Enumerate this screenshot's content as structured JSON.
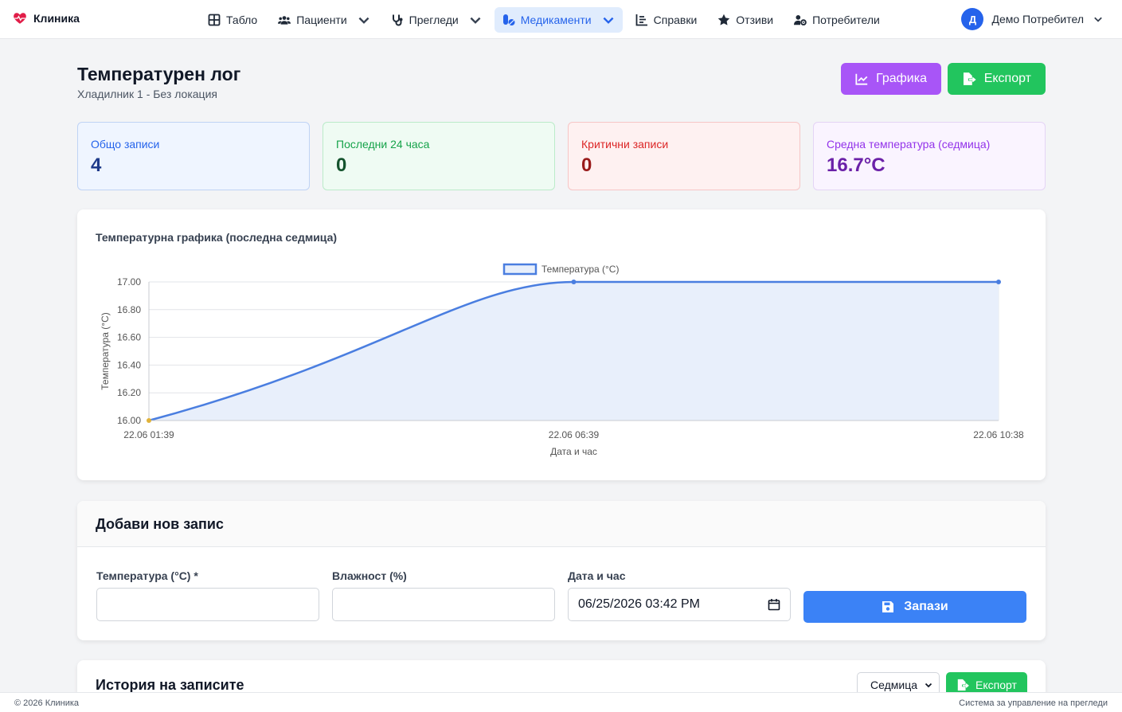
{
  "nav": {
    "brand": "Клиника",
    "items": [
      {
        "label": "Табло",
        "icon": "grid-icon",
        "dropdown": false
      },
      {
        "label": "Пациенти",
        "icon": "users-icon",
        "dropdown": true
      },
      {
        "label": "Прегледи",
        "icon": "stethoscope-icon",
        "dropdown": true
      },
      {
        "label": "Медикаменти",
        "icon": "pills-icon",
        "dropdown": true,
        "active": true
      },
      {
        "label": "Справки",
        "icon": "chart-list-icon",
        "dropdown": false
      },
      {
        "label": "Отзиви",
        "icon": "star-icon",
        "dropdown": false
      },
      {
        "label": "Потребители",
        "icon": "users-gear-icon",
        "dropdown": false
      }
    ],
    "user_initial": "Д",
    "user_name": "Демо Потребител"
  },
  "header": {
    "title": "Температурен лог",
    "subtitle": "Хладилник 1 - Без локация",
    "chart_button": "Графика",
    "export_button": "Експорт"
  },
  "stats": [
    {
      "label": "Общо записи",
      "value": "4"
    },
    {
      "label": "Последни 24 часа",
      "value": "0"
    },
    {
      "label": "Критични записи",
      "value": "0"
    },
    {
      "label": "Средна температура (седмица)",
      "value": "16.7°C"
    }
  ],
  "chart_section": {
    "title": "Температурна графика (последна седмица)"
  },
  "chart_data": {
    "type": "line",
    "legend": "Температура (°C)",
    "legend_position": "top-center",
    "x": [
      "22.06 01:39",
      "22.06 06:39",
      "22.06 10:38"
    ],
    "values": [
      16.0,
      17.0,
      17.0
    ],
    "xlabel": "Дата и час",
    "ylabel": "Температура (°C)",
    "ylim": [
      16.0,
      17.0
    ],
    "yticks": [
      "17.00",
      "16.80",
      "16.60",
      "16.40",
      "16.20",
      "16.00"
    ],
    "grid": true,
    "colors": {
      "line": "#4a7ee0",
      "fill": "#e8effb",
      "first_point": "#e0b23a"
    }
  },
  "form": {
    "title": "Добави нов запис",
    "temperature_label": "Температура (°C) *",
    "temperature_value": "",
    "humidity_label": "Влажност (%)",
    "humidity_value": "",
    "datetime_label": "Дата и час",
    "datetime_value": "06/25/2026 03:42 PM",
    "save_button": "Запази"
  },
  "history": {
    "title": "История на записите",
    "period_select": "Седмица",
    "export_button": "Експорт"
  },
  "footer": {
    "left": "© 2026 Клиника",
    "right": "Система за управление на прегледи"
  }
}
